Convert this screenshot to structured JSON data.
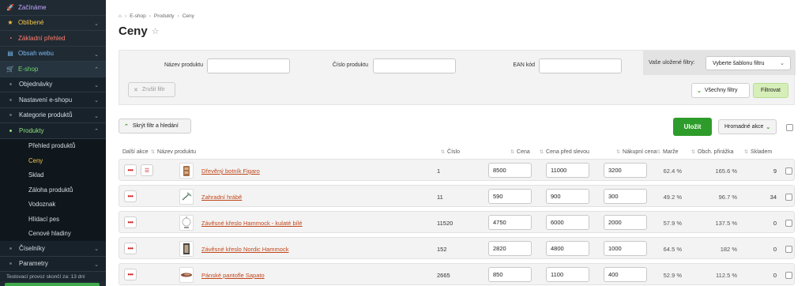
{
  "sidebar": {
    "top": [
      {
        "label": "Začínáme",
        "icon": "rocket-icon"
      },
      {
        "label": "Oblíbené",
        "icon": "star-icon"
      },
      {
        "label": "Základní přehled",
        "icon": "speedometer-icon"
      },
      {
        "label": "Obsah webu",
        "icon": "page-icon"
      },
      {
        "label": "E-shop",
        "icon": "cart-icon"
      }
    ],
    "eshop_sub": [
      {
        "label": "Objednávky"
      },
      {
        "label": "Nastavení e-shopu"
      },
      {
        "label": "Kategorie produktů"
      },
      {
        "label": "Produkty"
      }
    ],
    "products_sub": [
      {
        "label": "Přehled produktů"
      },
      {
        "label": "Ceny"
      },
      {
        "label": "Sklad"
      },
      {
        "label": "Záloha produktů"
      },
      {
        "label": "Vodoznak"
      },
      {
        "label": "Hlídací pes"
      },
      {
        "label": "Cenové hladiny"
      }
    ],
    "bottom": [
      {
        "label": "Číselníky"
      },
      {
        "label": "Parametry"
      }
    ],
    "trial_text": "Testovací provoz skončí za: 13 dní"
  },
  "breadcrumb": {
    "home_icon": "home-icon",
    "items": [
      "E-shop",
      "Produkty",
      "Ceny"
    ]
  },
  "page": {
    "title": "Ceny"
  },
  "filter": {
    "name_label": "Název produktu",
    "number_label": "Číslo produktu",
    "ean_label": "EAN kód",
    "name_value": "",
    "number_value": "",
    "ean_value": "",
    "saved_label": "Vaše uložené filtry:",
    "saved_select": "Vyberte šablonu filtru",
    "clear_label": "Zrušit filtr",
    "all_filters_label": "Všechny filtry",
    "filter_button": "Filtrovat"
  },
  "actions": {
    "hide_filter": "Skrýt filtr a hledání",
    "save": "Uložit",
    "bulk": "Hromadné akce"
  },
  "table": {
    "headers": {
      "actions": "Další akce",
      "name": "Název produktu",
      "number": "Číslo",
      "price": "Cena",
      "price_before": "Cena před slevou",
      "purchase": "Nákupní cena",
      "margin": "Marže",
      "markup": "Obch. přirážka",
      "stock": "Skladem"
    },
    "rows": [
      {
        "name": "Dřevěný botník Figaro",
        "number": "1",
        "price": "8500",
        "price_before": "11000",
        "purchase": "3200",
        "margin": "62.4 %",
        "markup": "165.6 %",
        "stock": "9"
      },
      {
        "name": "Zahradní hrábě",
        "number": "11",
        "price": "590",
        "price_before": "900",
        "purchase": "300",
        "margin": "49.2 %",
        "markup": "96.7 %",
        "stock": "34"
      },
      {
        "name": "Závěsné křeslo Hammock - kulaté bílé",
        "number": "11520",
        "price": "4750",
        "price_before": "6000",
        "purchase": "2000",
        "margin": "57.9 %",
        "markup": "137.5 %",
        "stock": "0"
      },
      {
        "name": "Závěsné křeslo Nordic Hammock",
        "number": "152",
        "price": "2820",
        "price_before": "4800",
        "purchase": "1000",
        "margin": "64.5 %",
        "markup": "182 %",
        "stock": "0"
      },
      {
        "name": "Pánské pantofle Sapato",
        "number": "2665",
        "price": "850",
        "price_before": "1100",
        "purchase": "400",
        "margin": "52.9 %",
        "markup": "112.5 %",
        "stock": "0"
      }
    ]
  }
}
